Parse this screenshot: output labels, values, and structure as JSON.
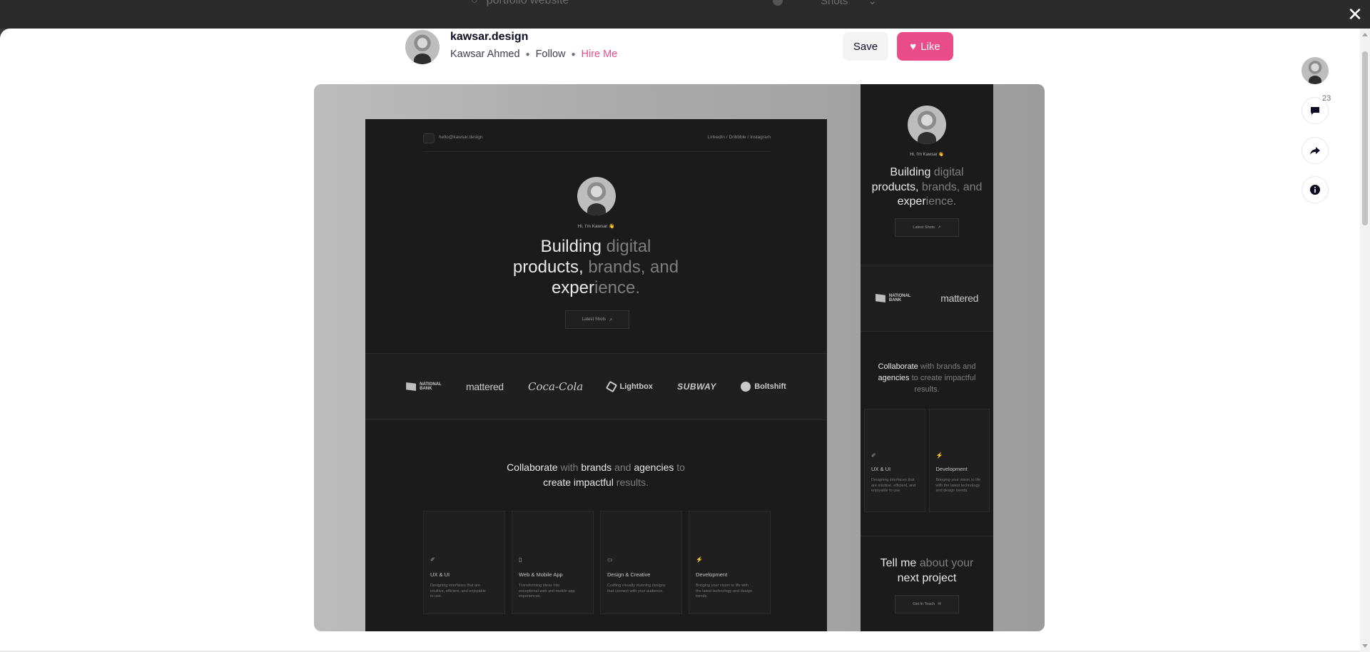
{
  "topbar": {
    "search_text": "portfolio website",
    "filter_label": "Shots"
  },
  "shot": {
    "title": "kawsar.design",
    "author": "Kawsar Ahmed",
    "follow_label": "Follow",
    "hire_label": "Hire Me",
    "save_label": "Save",
    "like_label": "Like"
  },
  "sidebar": {
    "comment_count": "23"
  },
  "preview": {
    "desktop": {
      "email": "hello@kawsar.design",
      "nav_links": "LinkedIn  /  Dribbble  /  Instagram",
      "greeting": "Hi, I'm Kawsar 👋",
      "headline_bright_1": "Building ",
      "headline_dim_1": "digital",
      "headline_bright_2": "products, ",
      "headline_dim_2": "brands, and",
      "headline_bright_3": "exper",
      "headline_dim_3": "ience.",
      "cta": "Latest Shots",
      "logos": {
        "national_bank_1": "NATIONAL",
        "national_bank_2": "BANK",
        "mattered": "mattered",
        "cocacola": "Coca-Cola",
        "lightbox": "Lightbox",
        "subway": "SUBWAY",
        "boltshift": "Boltshift"
      },
      "collab_bright_1": "Collaborate",
      "collab_dim_1": " with ",
      "collab_bright_2": "brands",
      "collab_dim_2": " and ",
      "collab_bright_3": "agencies",
      "collab_dim_3": " to",
      "collab_bright_4": "create impactful",
      "collab_dim_4": " results.",
      "services": [
        {
          "title": "UX & UI",
          "desc": "Designing interfaces that are intuitive, efficient, and enjoyable to use.",
          "icon": "✐"
        },
        {
          "title": "Web & Mobile App",
          "desc": "Transforming ideas into exceptional web and mobile app experiences.",
          "icon": "▯"
        },
        {
          "title": "Design & Creative",
          "desc": "Crafting visually stunning designs that connect with your audience.",
          "icon": "▭"
        },
        {
          "title": "Development",
          "desc": "Bringing your vision to life with the latest technology and design trends.",
          "icon": "⚡"
        }
      ]
    },
    "mobile": {
      "greeting": "Hi, I'm Kawsar 👋",
      "cta": "Latest Shots",
      "collab_bright_1": "Collaborate",
      "collab_dim_1": " with brands and",
      "collab_bright_2": "agencies",
      "collab_dim_2": " to create impactful",
      "collab_dim_3": "results.",
      "services": [
        {
          "title": "UX & UI",
          "desc": "Designing interfaces that are intuitive, efficient, and enjoyable to use.",
          "icon": "✐"
        },
        {
          "title": "Development",
          "desc": "Bringing your vision to life with the latest technology and design trends.",
          "icon": "⚡"
        }
      ],
      "tell_bright_1": "Tell me",
      "tell_dim_1": " about your",
      "tell_bright_2": "next project",
      "cta2": "Get In Touch"
    }
  },
  "colors": {
    "accent_pink": "#ea4c89",
    "modal_bg": "#ffffff",
    "overlay_bg": "#2b2b2b",
    "shot_dark": "#1b1b1b"
  }
}
